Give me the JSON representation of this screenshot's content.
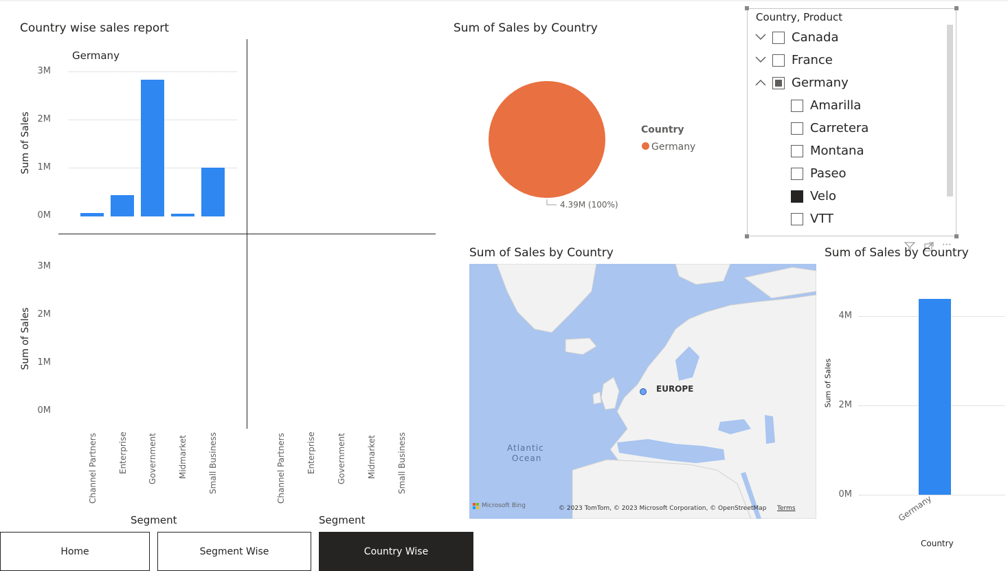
{
  "segment_report": {
    "title": "Country wise sales report",
    "panel_label": "Germany",
    "y_axis_label": "Sum of Sales",
    "x_axis_label": "Segment",
    "y_ticks_top": [
      "3M",
      "2M",
      "1M",
      "0M"
    ],
    "y_ticks_bottom": [
      "3M",
      "2M",
      "1M",
      "0M"
    ],
    "categories": [
      "Channel Partners",
      "Enterprise",
      "Government",
      "Midmarket",
      "Small Business"
    ],
    "categories_right": [
      "Channel Partners",
      "Enterprise",
      "Government",
      "Midmarket",
      "Small Business"
    ]
  },
  "pie_chart": {
    "title": "Sum of Sales by Country",
    "legend_title": "Country",
    "legend_item": "Germany",
    "slice_label": "4.39M (100%)"
  },
  "slicer": {
    "header": "Country, Product",
    "items": [
      {
        "label": "Canada",
        "state": "unchecked",
        "expand": "collapsed",
        "level": 0
      },
      {
        "label": "France",
        "state": "unchecked",
        "expand": "collapsed",
        "level": 0
      },
      {
        "label": "Germany",
        "state": "partial",
        "expand": "expanded",
        "level": 0
      },
      {
        "label": "Amarilla",
        "state": "unchecked",
        "level": 1
      },
      {
        "label": "Carretera",
        "state": "unchecked",
        "level": 1
      },
      {
        "label": "Montana",
        "state": "unchecked",
        "level": 1
      },
      {
        "label": "Paseo",
        "state": "unchecked",
        "level": 1
      },
      {
        "label": "Velo",
        "state": "checked",
        "level": 1
      },
      {
        "label": "VTT",
        "state": "unchecked",
        "level": 1
      }
    ]
  },
  "map_visual": {
    "title": "Sum of Sales by Country",
    "region_label": "EUROPE",
    "ocean_label_1": "Atlantic",
    "ocean_label_2": "Ocean",
    "bing_label": "Microsoft Bing",
    "attribution": "© 2023 TomTom, © 2023 Microsoft Corporation, © OpenStreetMap",
    "terms_label": "Terms"
  },
  "country_bar": {
    "title": "Sum of Sales by Country",
    "y_axis_label": "Sum of Sales",
    "x_axis_label": "Country",
    "y_ticks": [
      "4M",
      "2M",
      "0M"
    ],
    "category": "Germany"
  },
  "nav": {
    "home": "Home",
    "segment": "Segment Wise",
    "country": "Country Wise"
  },
  "colors": {
    "bar": "#2f87f1",
    "pie": "#e97040",
    "nav_active": "#252423",
    "map_water": "#a9c5f0",
    "map_land": "#f2f2f2"
  },
  "chart_data": [
    {
      "type": "bar",
      "title": "Country wise sales report",
      "panel": "Germany",
      "categories": [
        "Channel Partners",
        "Enterprise",
        "Government",
        "Midmarket",
        "Small Business"
      ],
      "values": [
        70000,
        440000,
        2830000,
        50000,
        1010000
      ],
      "ylabel": "Sum of Sales",
      "xlabel": "Segment",
      "ylim": [
        0,
        3000000
      ]
    },
    {
      "type": "pie",
      "title": "Sum of Sales by Country",
      "categories": [
        "Germany"
      ],
      "values": [
        4390000
      ]
    },
    {
      "type": "bar",
      "title": "Sum of Sales by Country",
      "categories": [
        "Germany"
      ],
      "values": [
        4390000
      ],
      "ylabel": "Sum of Sales",
      "xlabel": "Country",
      "ylim": [
        0,
        4000000
      ]
    }
  ]
}
